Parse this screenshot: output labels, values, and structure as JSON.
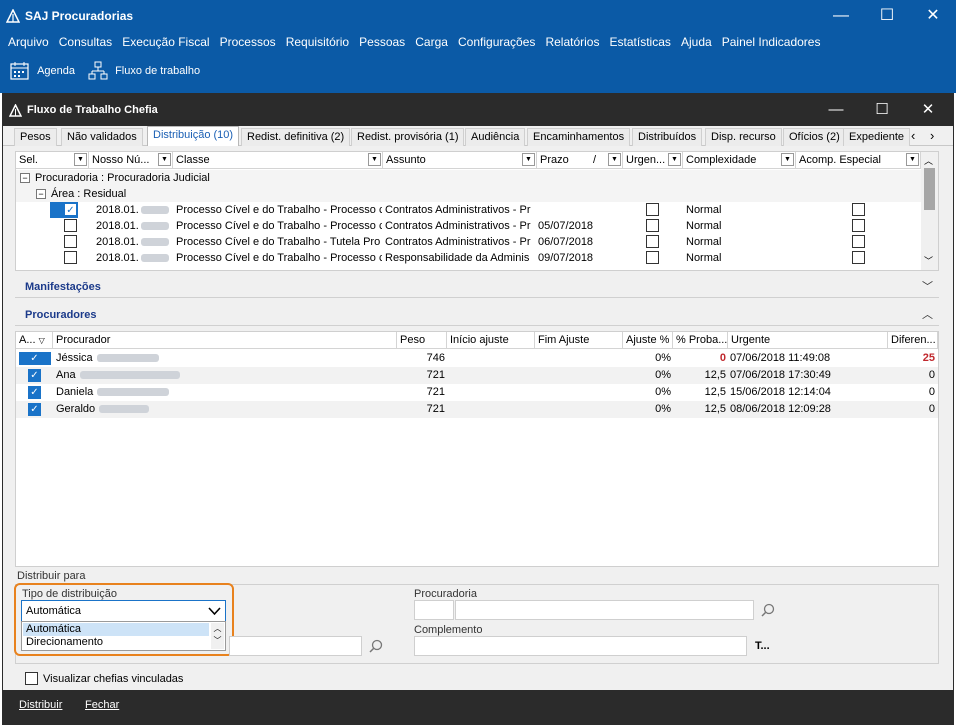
{
  "outer_window": {
    "title": "SAJ Procuradorias",
    "controls": {
      "minimize": "—",
      "maximize": "☐",
      "close": "✕"
    }
  },
  "menu": [
    "Arquivo",
    "Consultas",
    "Execução Fiscal",
    "Processos",
    "Requisitório",
    "Pessoas",
    "Carga",
    "Configurações",
    "Relatórios",
    "Estatísticas",
    "Ajuda",
    "Painel Indicadores"
  ],
  "toolbar": {
    "agenda": "Agenda",
    "fluxo": "Fluxo de trabalho"
  },
  "inner_window": {
    "title": "Fluxo de Trabalho Chefia",
    "controls": {
      "minimize": "—",
      "maximize": "☐",
      "close": "✕"
    }
  },
  "tabs": [
    "Pesos",
    "Não validados",
    "Distribuição (10)",
    "Redist. definitiva (2)",
    "Redist. provisória (1)",
    "Audiência",
    "Encaminhamentos",
    "Distribuídos",
    "Disp. recurso",
    "Ofícios (2)",
    "Expediente"
  ],
  "tabs_nav": {
    "prev": "‹",
    "next": "›"
  },
  "grid1": {
    "columns": [
      "Sel.",
      "Nosso Nú...",
      "Classe",
      "Assunto",
      "Prazo",
      "/",
      "Urgen...",
      "Complexidade",
      "Acomp. Especial"
    ],
    "group1": "Procuradoria : Procuradoria Judicial",
    "group2": "Área : Residual",
    "rows": [
      {
        "numero": "2018.01.",
        "classe": "Processo Cível e do Trabalho - Processo c",
        "assunto": "Contratos Administrativos - Pr",
        "prazo": "",
        "complexidade": "Normal",
        "checked": true
      },
      {
        "numero": "2018.01.",
        "classe": "Processo Cível e do Trabalho - Processo c",
        "assunto": "Contratos Administrativos - Pr",
        "prazo": "05/07/2018",
        "complexidade": "Normal",
        "checked": false
      },
      {
        "numero": "2018.01.",
        "classe": "Processo Cível e do Trabalho - Tutela Pro",
        "assunto": "Contratos Administrativos - Pr",
        "prazo": "06/07/2018",
        "complexidade": "Normal",
        "checked": false
      },
      {
        "numero": "2018.01.",
        "classe": "Processo Cível e do Trabalho - Processo c",
        "assunto": "Responsabilidade da Adminis",
        "prazo": "09/07/2018",
        "complexidade": "Normal",
        "checked": false
      }
    ]
  },
  "manifestacoes": {
    "title": "Manifestações"
  },
  "procuradores": {
    "title": "Procuradores",
    "columns": [
      "A...",
      "Procurador",
      "Peso",
      "Início ajuste",
      "Fim Ajuste",
      "Ajuste %",
      "% Proba...",
      "Urgente",
      "Diferen..."
    ],
    "rows": [
      {
        "nome": "Jéssica",
        "peso": "746",
        "ajuste": "0%",
        "prob": "0",
        "urgente": "07/06/2018 11:49:08",
        "dif": "25",
        "highlight": true
      },
      {
        "nome": "Ana",
        "peso": "721",
        "ajuste": "0%",
        "prob": "12,5",
        "urgente": "07/06/2018 17:30:49",
        "dif": "0",
        "highlight": false
      },
      {
        "nome": "Daniela",
        "peso": "721",
        "ajuste": "0%",
        "prob": "12,5",
        "urgente": "15/06/2018 12:14:04",
        "dif": "0",
        "highlight": false
      },
      {
        "nome": "Geraldo",
        "peso": "721",
        "ajuste": "0%",
        "prob": "12,5",
        "urgente": "08/06/2018 12:09:28",
        "dif": "0",
        "highlight": false
      }
    ]
  },
  "distribuir_para": {
    "label": "Distribuir para",
    "tipo_label": "Tipo de distribuição",
    "tipo_value": "Automática",
    "tipo_options": [
      "Automática",
      "Direcionamento"
    ],
    "procuradoria_label": "Procuradoria",
    "complemento_label": "Complemento",
    "t_button": "T..."
  },
  "visualizar_label": "Visualizar chefias vinculadas",
  "actions": {
    "distribuir": "Distribuir",
    "fechar": "Fechar"
  },
  "colors": {
    "brand_blue": "#0b5aa6",
    "dark_title": "#2b2b2b",
    "focus_orange": "#e8821e",
    "alert_red": "#c0282d"
  }
}
